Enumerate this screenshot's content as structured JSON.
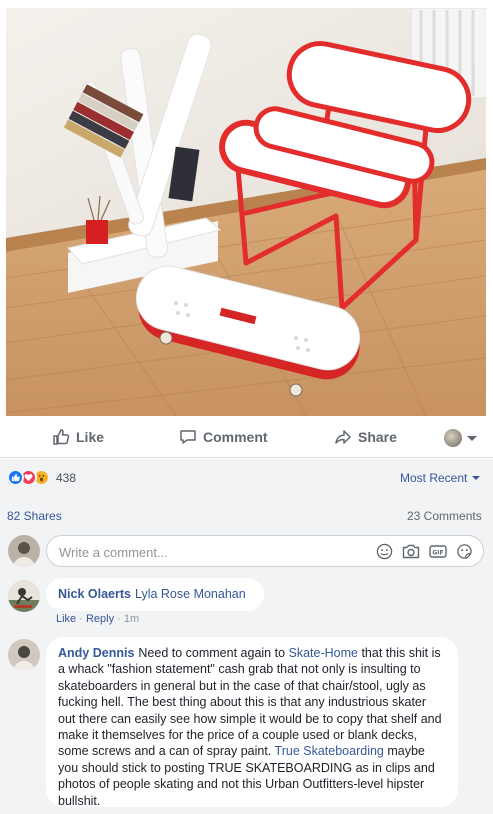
{
  "post": {
    "photo_alt": "skateboard-furniture-photo"
  },
  "actions": {
    "like_label": "Like",
    "comment_label": "Comment",
    "share_label": "Share"
  },
  "reactions": {
    "count": "438",
    "types": [
      "like",
      "love",
      "wow"
    ],
    "colors": {
      "like": "#1877f2",
      "love": "#f33e58",
      "wow": "#f7b125"
    }
  },
  "sort": {
    "label": "Most Recent"
  },
  "stats": {
    "shares": "82 Shares",
    "comments": "23 Comments"
  },
  "composer": {
    "placeholder": "Write a comment..."
  },
  "comments": [
    {
      "author": "Nick Olaerts",
      "text_parts": [
        {
          "kind": "tag",
          "text": "Lyla Rose Monahan"
        }
      ],
      "actions": {
        "like": "Like",
        "reply": "Reply",
        "time": "1m"
      }
    },
    {
      "author": "Andy Dennis",
      "text_parts": [
        {
          "kind": "text",
          "text": "Need to comment again to "
        },
        {
          "kind": "tag",
          "text": "Skate-Home"
        },
        {
          "kind": "text",
          "text": " that this shit is a whack \"fashion statement\" cash grab that not only is insulting to skateboarders in general but in the case of that chair/stool, ugly as fucking hell. The best thing about this is that any industrious skater out there can easily see how simple it would be to copy that shelf and make it themselves for the price of a couple used or blank decks, some screws and a can of spray paint. "
        },
        {
          "kind": "tag",
          "text": "True Skateboarding"
        },
        {
          "kind": "text",
          "text": " maybe you should stick to posting TRUE SKATEBOARDING as in clips and photos of people skating and not this Urban Outfitters-level hipster bullshit."
        }
      ]
    }
  ],
  "colors": {
    "link": "#365899",
    "panel_bg": "#f2f3f5",
    "muted": "#90949c",
    "accent_red": "#e32d2d"
  }
}
